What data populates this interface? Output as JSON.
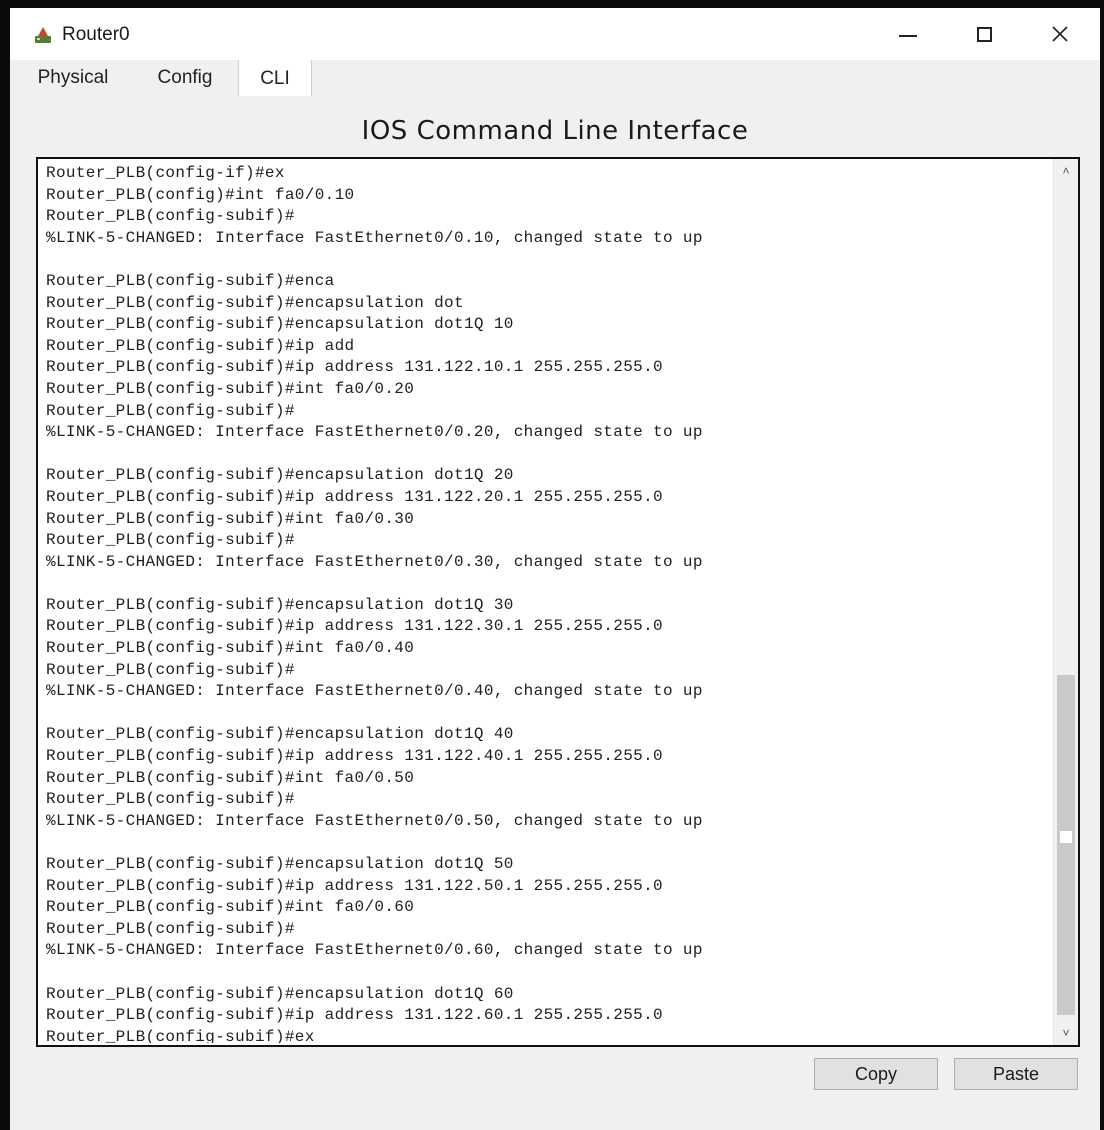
{
  "window": {
    "title": "Router0",
    "icon": "router-icon",
    "controls": {
      "minimize": "minimize-icon",
      "maximize": "maximize-icon",
      "close": "✕"
    }
  },
  "tabs": [
    {
      "label": "Physical",
      "active": false
    },
    {
      "label": "Config",
      "active": false
    },
    {
      "label": "CLI",
      "active": true
    }
  ],
  "cli": {
    "heading": "IOS Command Line Interface",
    "lines": [
      "Router_PLB(config-if)#ex",
      "Router_PLB(config)#int fa0/0.10",
      "Router_PLB(config-subif)#",
      "%LINK-5-CHANGED: Interface FastEthernet0/0.10, changed state to up",
      "",
      "Router_PLB(config-subif)#enca",
      "Router_PLB(config-subif)#encapsulation dot",
      "Router_PLB(config-subif)#encapsulation dot1Q 10",
      "Router_PLB(config-subif)#ip add",
      "Router_PLB(config-subif)#ip address 131.122.10.1 255.255.255.0",
      "Router_PLB(config-subif)#int fa0/0.20",
      "Router_PLB(config-subif)#",
      "%LINK-5-CHANGED: Interface FastEthernet0/0.20, changed state to up",
      "",
      "Router_PLB(config-subif)#encapsulation dot1Q 20",
      "Router_PLB(config-subif)#ip address 131.122.20.1 255.255.255.0",
      "Router_PLB(config-subif)#int fa0/0.30",
      "Router_PLB(config-subif)#",
      "%LINK-5-CHANGED: Interface FastEthernet0/0.30, changed state to up",
      "",
      "Router_PLB(config-subif)#encapsulation dot1Q 30",
      "Router_PLB(config-subif)#ip address 131.122.30.1 255.255.255.0",
      "Router_PLB(config-subif)#int fa0/0.40",
      "Router_PLB(config-subif)#",
      "%LINK-5-CHANGED: Interface FastEthernet0/0.40, changed state to up",
      "",
      "Router_PLB(config-subif)#encapsulation dot1Q 40",
      "Router_PLB(config-subif)#ip address 131.122.40.1 255.255.255.0",
      "Router_PLB(config-subif)#int fa0/0.50",
      "Router_PLB(config-subif)#",
      "%LINK-5-CHANGED: Interface FastEthernet0/0.50, changed state to up",
      "",
      "Router_PLB(config-subif)#encapsulation dot1Q 50",
      "Router_PLB(config-subif)#ip address 131.122.50.1 255.255.255.0",
      "Router_PLB(config-subif)#int fa0/0.60",
      "Router_PLB(config-subif)#",
      "%LINK-5-CHANGED: Interface FastEthernet0/0.60, changed state to up",
      "",
      "Router_PLB(config-subif)#encapsulation dot1Q 60",
      "Router_PLB(config-subif)#ip address 131.122.60.1 255.255.255.0",
      "Router_PLB(config-subif)#ex"
    ]
  },
  "scrollbar": {
    "up": "˄",
    "down": "˅"
  },
  "buttons": {
    "copy": "Copy",
    "paste": "Paste"
  }
}
